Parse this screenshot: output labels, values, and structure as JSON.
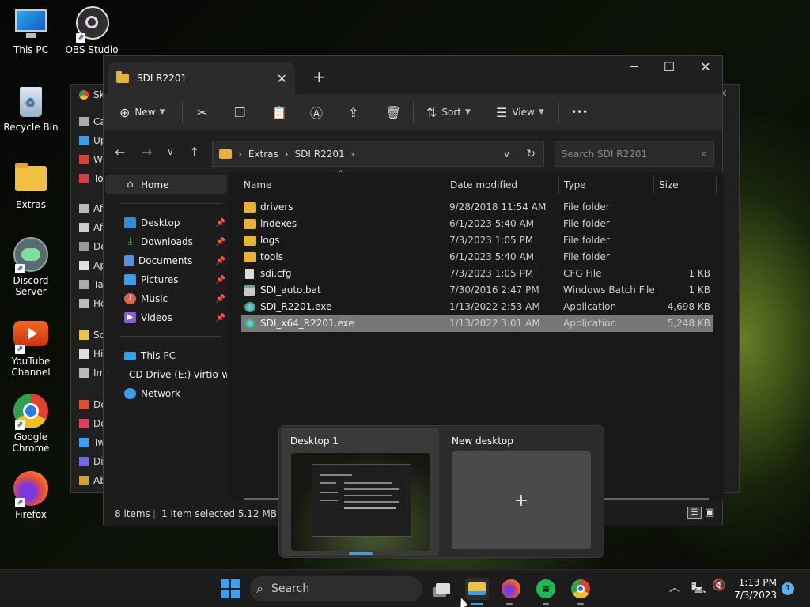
{
  "desktop": {
    "icons": [
      {
        "label": "This PC",
        "icon": "monitor-icon"
      },
      {
        "label": "OBS Studio",
        "icon": "obs-icon"
      },
      {
        "label": "Recycle Bin",
        "icon": "recycle-bin-icon"
      },
      {
        "label": "Extras",
        "icon": "folder-icon"
      },
      {
        "label": "Discord Server",
        "icon": "discord-icon"
      },
      {
        "label": "YouTube Channel",
        "icon": "youtube-icon"
      },
      {
        "label": "Google Chrome",
        "icon": "chrome-icon"
      },
      {
        "label": "Firefox",
        "icon": "firefox-icon"
      }
    ]
  },
  "bg_window": {
    "title": "Sk",
    "items": [
      "Ca",
      "Up",
      "W",
      "To",
      "Af",
      "Af",
      "De",
      "Ap",
      "Ta",
      "Ho",
      "Sc",
      "Hi",
      "Im",
      "De",
      "Do",
      "Tw",
      "Di",
      "Ab"
    ]
  },
  "explorer": {
    "tab_title": "SDI R2201",
    "toolbar": {
      "new_label": "New",
      "sort_label": "Sort",
      "view_label": "View",
      "more_label": "•••"
    },
    "address": {
      "crumbs": [
        "Extras",
        "SDI R2201"
      ],
      "search_placeholder": "Search SDI R2201"
    },
    "sidebar": {
      "home": "Home",
      "quick": [
        {
          "label": "Desktop",
          "color": "#2b8ee0"
        },
        {
          "label": "Downloads",
          "color": "#3fb870"
        },
        {
          "label": "Documents",
          "color": "#5a8fe0"
        },
        {
          "label": "Pictures",
          "color": "#3a9fe8"
        },
        {
          "label": "Music",
          "color": "#e0604a"
        },
        {
          "label": "Videos",
          "color": "#8a5ae0"
        }
      ],
      "drives": [
        "This PC",
        "CD Drive (E:) virtio-w",
        "Network"
      ]
    },
    "columns": {
      "name": "Name",
      "date": "Date modified",
      "type": "Type",
      "size": "Size"
    },
    "files": [
      {
        "name": "drivers",
        "date": "9/28/2018 11:54 AM",
        "type": "File folder",
        "size": "",
        "kind": "folder"
      },
      {
        "name": "indexes",
        "date": "6/1/2023 5:40 AM",
        "type": "File folder",
        "size": "",
        "kind": "folder"
      },
      {
        "name": "logs",
        "date": "7/3/2023 1:05 PM",
        "type": "File folder",
        "size": "",
        "kind": "folder"
      },
      {
        "name": "tools",
        "date": "6/1/2023 5:40 AM",
        "type": "File folder",
        "size": "",
        "kind": "folder"
      },
      {
        "name": "sdi.cfg",
        "date": "7/3/2023 1:05 PM",
        "type": "CFG File",
        "size": "1 KB",
        "kind": "file"
      },
      {
        "name": "SDI_auto.bat",
        "date": "7/30/2016 2:47 PM",
        "type": "Windows Batch File",
        "size": "1 KB",
        "kind": "bat"
      },
      {
        "name": "SDI_R2201.exe",
        "date": "1/13/2022 2:53 AM",
        "type": "Application",
        "size": "4,698 KB",
        "kind": "app"
      },
      {
        "name": "SDI_x64_R2201.exe",
        "date": "1/13/2022 3:01 AM",
        "type": "Application",
        "size": "5,248 KB",
        "kind": "app",
        "selected": true
      }
    ],
    "status": {
      "count": "8 items",
      "selection": "1 item selected  5.12 MB"
    }
  },
  "taskview": {
    "desktop1": "Desktop 1",
    "new_desktop": "New desktop",
    "plus": "+"
  },
  "taskbar": {
    "search_label": "Search",
    "time": "1:13 PM",
    "date": "7/3/2023",
    "notifications": "1"
  }
}
